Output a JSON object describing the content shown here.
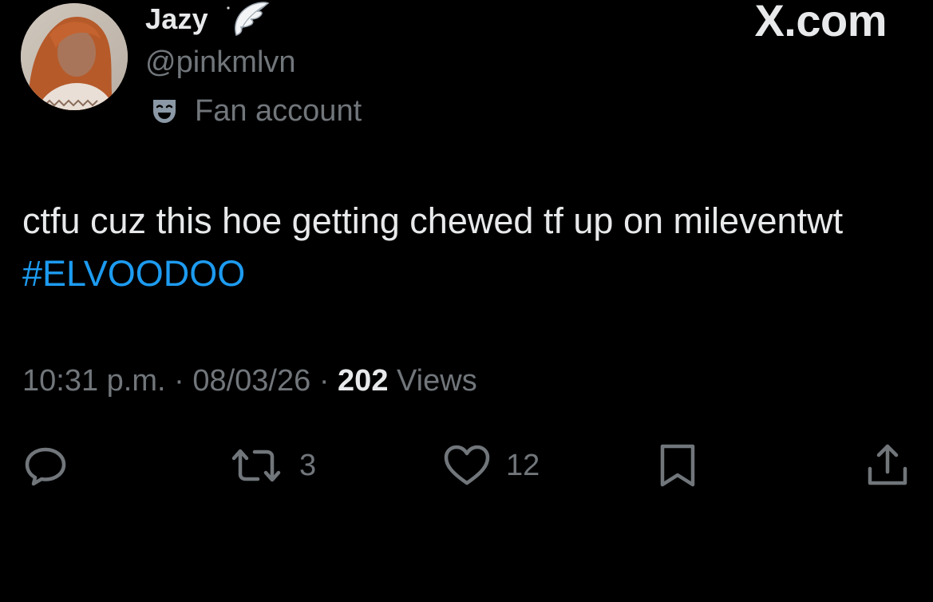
{
  "header": {
    "display_name": "Jazy",
    "handle": "@pinkmlvn",
    "label": "Fan account",
    "brand": "X.com"
  },
  "tweet": {
    "text": "ctfu cuz this hoe getting chewed tf up on mileventwt",
    "hashtag": "#ELVOODOO"
  },
  "meta": {
    "time": "10:31 p.m.",
    "separator": "·",
    "date": "08/03/26",
    "views_count": "202",
    "views_label": "Views"
  },
  "actions": {
    "reply_icon": "speech-bubble-icon",
    "retweet_icon": "retweet-arrows-icon",
    "retweet_count": "3",
    "like_icon": "heart-icon",
    "like_count": "12",
    "bookmark_icon": "bookmark-icon",
    "share_icon": "share-upload-icon"
  },
  "colors": {
    "background": "#000000",
    "primary_text": "#e7e9ea",
    "secondary_text": "#71767b",
    "link": "#1d9bf0"
  }
}
